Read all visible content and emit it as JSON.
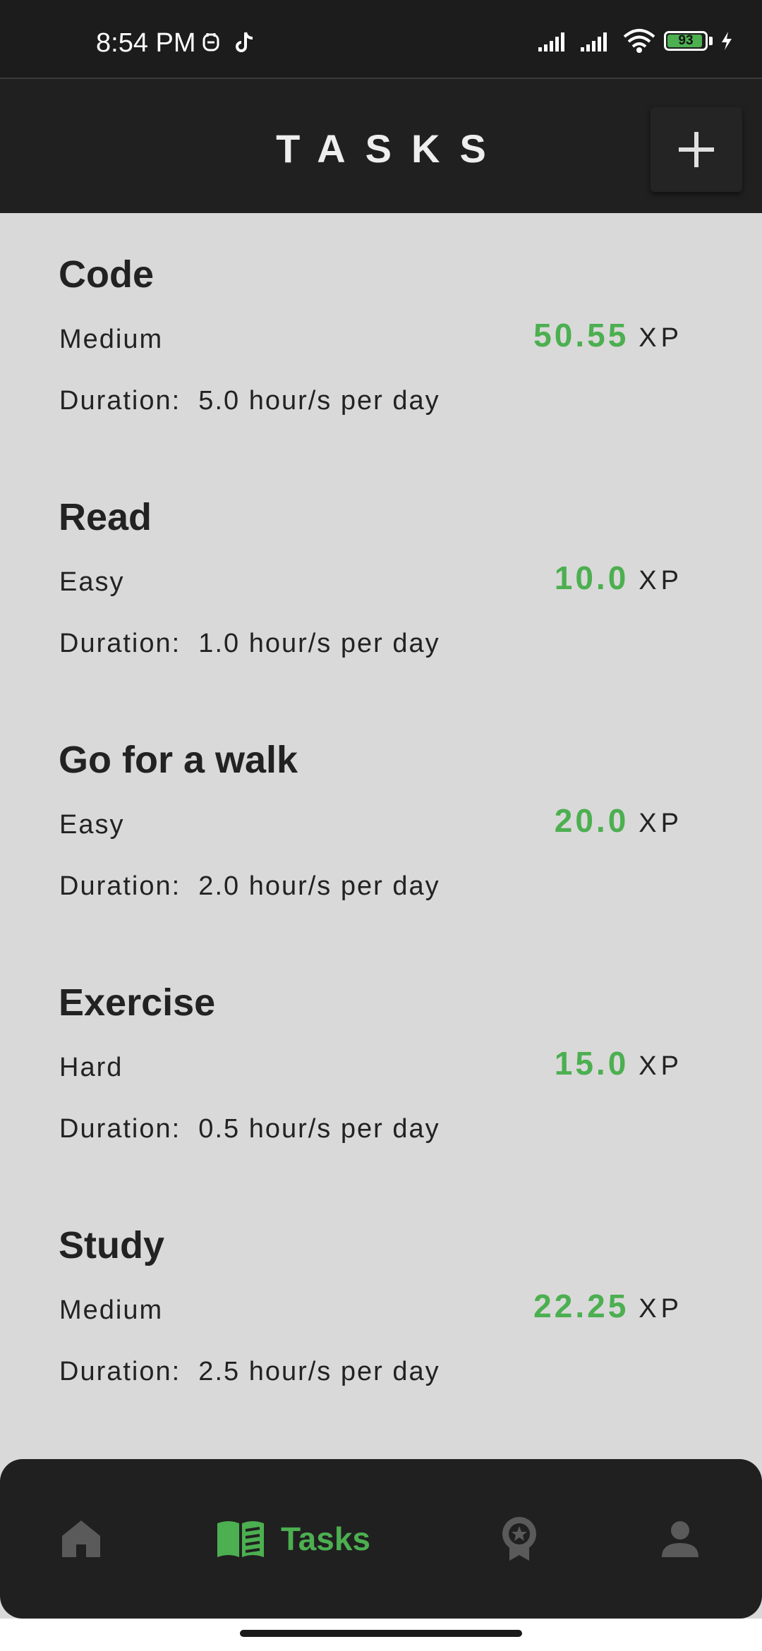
{
  "status_bar": {
    "time": "8:54 PM",
    "battery": "93"
  },
  "app_bar": {
    "title": "TASKS"
  },
  "tasks": [
    {
      "title": "Code",
      "difficulty": "Medium",
      "duration_label": "Duration:  5.0 hour/s per day",
      "xp": "50.55",
      "xp_unit": "XP"
    },
    {
      "title": "Read",
      "difficulty": "Easy",
      "duration_label": "Duration:  1.0 hour/s per day",
      "xp": "10.0",
      "xp_unit": "XP"
    },
    {
      "title": "Go for a walk",
      "difficulty": "Easy",
      "duration_label": "Duration:  2.0 hour/s per day",
      "xp": "20.0",
      "xp_unit": "XP"
    },
    {
      "title": "Exercise",
      "difficulty": "Hard",
      "duration_label": "Duration:  0.5 hour/s per day",
      "xp": "15.0",
      "xp_unit": "XP"
    },
    {
      "title": "Study",
      "difficulty": "Medium",
      "duration_label": "Duration:  2.5 hour/s per day",
      "xp": "22.25",
      "xp_unit": "XP"
    }
  ],
  "bottom_nav": {
    "items": [
      {
        "icon": "home-icon",
        "label": ""
      },
      {
        "icon": "book-icon",
        "label": "Tasks"
      },
      {
        "icon": "badge-icon",
        "label": ""
      },
      {
        "icon": "person-icon",
        "label": ""
      }
    ],
    "active_index": 1
  },
  "colors": {
    "accent": "#4caf50",
    "background": "#d9d9d9",
    "bar": "#202020",
    "text": "#222222"
  }
}
